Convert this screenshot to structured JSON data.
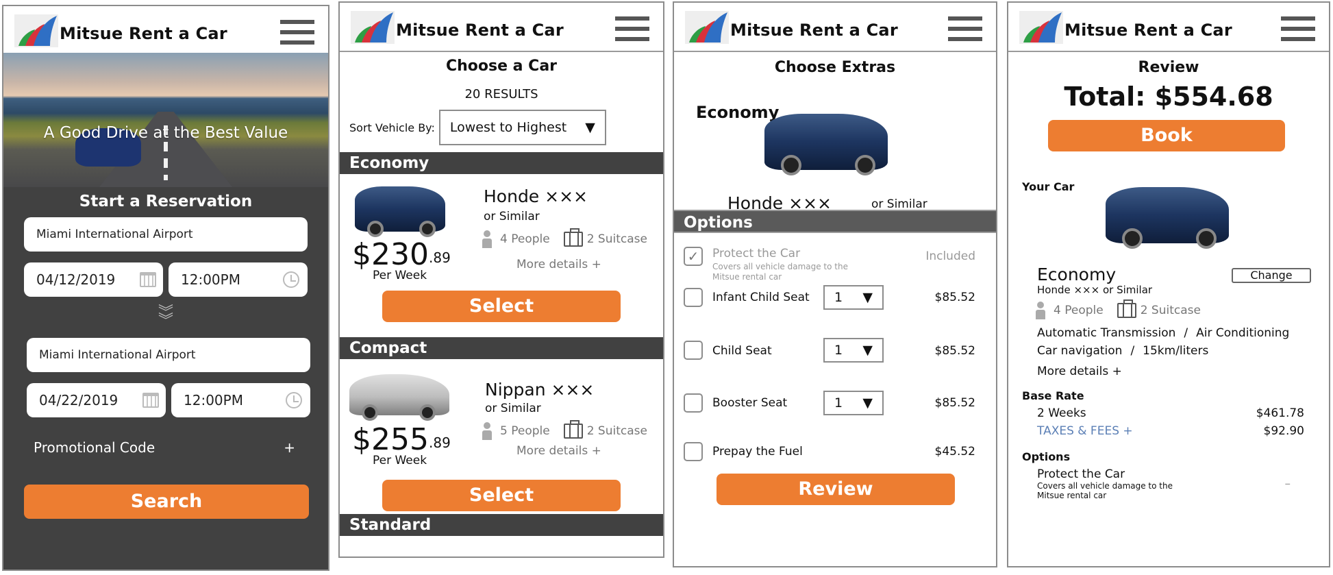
{
  "brand": {
    "name": "Mitsue Rent a Car",
    "logo_icon": "wing-logo-icon",
    "menu_icon": "hamburger-menu-icon"
  },
  "colors": {
    "accent": "#ed7d31",
    "dark_panel": "#414141",
    "options_bar": "#5a5a5a",
    "link": "#5b7fb5"
  },
  "screen1": {
    "hero_tagline": "A Good Drive at the Best Value",
    "heading": "Start a Reservation",
    "pickup_location": "Miami International Airport",
    "pickup_date": "04/12/2019",
    "pickup_time": "12:00PM",
    "return_location": "Miami International Airport",
    "return_date": "04/22/2019",
    "return_time": "12:00PM",
    "promo_label": "Promotional Code",
    "promo_toggle": "+",
    "search_label": "Search"
  },
  "screen2": {
    "title": "Choose a Car",
    "results": "20 RESULTS",
    "sort_label": "Sort Vehicle By:",
    "sort_value": "Lowest to Highest",
    "categories": [
      {
        "name": "Economy",
        "model": "Honde ×××",
        "similar": "or Similar",
        "people": "4 People",
        "suitcase": "2 Suitcase",
        "price_main": "$230",
        "price_cents": ".89",
        "per": "Per Week",
        "more": "More details  +",
        "select": "Select"
      },
      {
        "name": "Compact",
        "model": "Nippan ×××",
        "similar": "or Similar",
        "people": "5 People",
        "suitcase": "2 Suitcase",
        "price_main": "$255",
        "price_cents": ".89",
        "per": "Per Week",
        "more": "More details  +",
        "select": "Select"
      },
      {
        "name": "Standard"
      }
    ]
  },
  "screen3": {
    "title": "Choose Extras",
    "category": "Economy",
    "model": "Honde ×××",
    "similar": "or Similar",
    "options_header": "Options",
    "options": [
      {
        "name": "Protect the Car",
        "desc_line1": "Covers all vehicle damage to the",
        "desc_line2": "Mitsue rental car",
        "checked": true,
        "price": "Included"
      },
      {
        "name": "Infant Child Seat",
        "qty": "1",
        "checked": false,
        "price": "$85.52"
      },
      {
        "name": "Child Seat",
        "qty": "1",
        "checked": false,
        "price": "$85.52"
      },
      {
        "name": "Booster Seat",
        "qty": "1",
        "checked": false,
        "price": "$85.52"
      },
      {
        "name": "Prepay the Fuel",
        "checked": false,
        "price": "$45.52"
      }
    ],
    "check_glyph": "✓",
    "review_label": "Review"
  },
  "screen4": {
    "title": "Review",
    "total": "Total: $554.68",
    "book_label": "Book",
    "your_car_label": "Your Car",
    "category": "Economy",
    "change_label": "Change",
    "model_similar": "Honde ××× or Similar",
    "people": "4 People",
    "suitcase": "2 Suitcase",
    "features_line1": [
      "Automatic Transmission",
      "/",
      "Air Conditioning"
    ],
    "features_line2": [
      "Car navigation",
      "/",
      "15km/liters"
    ],
    "more": "More details  +",
    "base_rate_header": "Base Rate",
    "duration": "2 Weeks",
    "base_price": "$461.78",
    "taxes_label": "TAXES & FEES  +",
    "taxes_price": "$92.90",
    "options_header": "Options",
    "option_name": "Protect the Car",
    "option_desc_line1": "Covers all vehicle damage to the",
    "option_desc_line2": "Mitsue rental car",
    "option_price": "–"
  }
}
